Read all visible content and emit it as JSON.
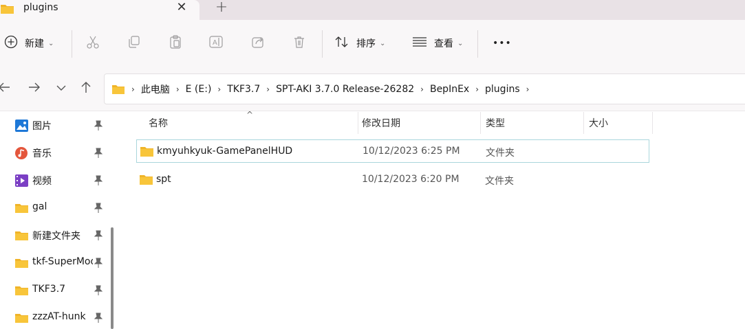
{
  "tabs": [
    {
      "title": "plugins",
      "active": true
    }
  ],
  "tab_new_symbol": "+",
  "tab_close_symbol": "✕",
  "toolbar": {
    "new_label": "新建",
    "sort_label": "排序",
    "view_label": "查看",
    "more_symbol": "•••"
  },
  "breadcrumb": [
    "此电脑",
    "E (E:)",
    "TKF3.7",
    "SPT-AKI 3.7.0 Release-26282",
    "BepInEx",
    "plugins"
  ],
  "sidebar": {
    "items": [
      {
        "label": "图片",
        "icon": "pictures-icon"
      },
      {
        "label": "音乐",
        "icon": "music-icon"
      },
      {
        "label": "视频",
        "icon": "videos-icon"
      },
      {
        "label": "gal",
        "icon": "folder-icon"
      },
      {
        "label": "新建文件夹",
        "icon": "folder-icon"
      },
      {
        "label": "tkf-SuperMod",
        "icon": "folder-icon"
      },
      {
        "label": "TKF3.7",
        "icon": "folder-icon"
      },
      {
        "label": "zzzAT-hunk",
        "icon": "folder-icon"
      }
    ]
  },
  "columns": {
    "name": "名称",
    "modified": "修改日期",
    "type": "类型",
    "size": "大小"
  },
  "files": [
    {
      "name": "kmyuhkyuk-GamePanelHUD",
      "modified": "10/12/2023 6:25 PM",
      "type": "文件夹",
      "selected": true
    },
    {
      "name": "spt",
      "modified": "10/12/2023 6:20 PM",
      "type": "文件夹",
      "selected": false
    }
  ],
  "colors": {
    "folder": "#f8c53a",
    "selection_border": "#a9d6dc",
    "tab_bar": "#e9e2e6"
  }
}
